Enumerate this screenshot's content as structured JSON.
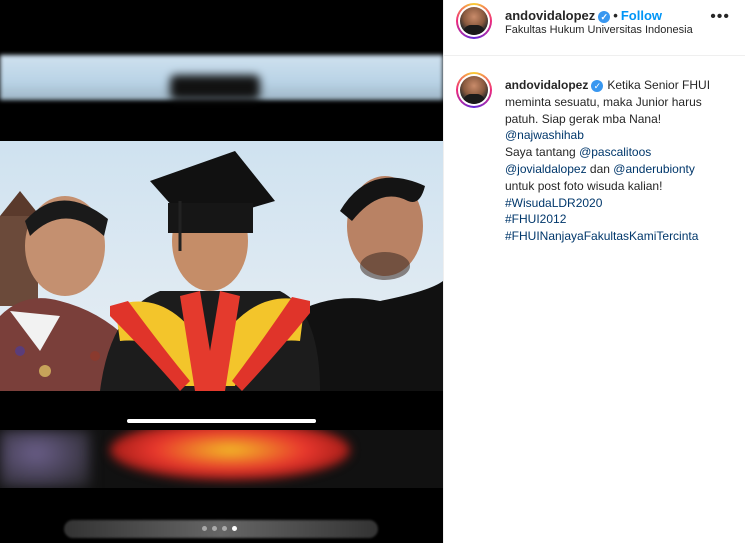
{
  "post": {
    "username": "andovidalopez",
    "verified_glyph": "✓",
    "separator": "•",
    "follow_label": "Follow",
    "location": "Fakultas Hukum Universitas Indonesia",
    "more_icon": "more-options-icon"
  },
  "caption": {
    "username": "andovidalopez",
    "lines": [
      [
        {
          "t": "text",
          "v": "Ketika Senior FHUI"
        }
      ],
      [
        {
          "t": "text",
          "v": "meminta sesuatu, maka Junior harus"
        }
      ],
      [
        {
          "t": "text",
          "v": "patuh. Siap gerak mba Nana!"
        }
      ],
      [
        {
          "t": "mention",
          "v": "@najwashihab"
        }
      ],
      [
        {
          "t": "text",
          "v": "Saya tantang "
        },
        {
          "t": "mention",
          "v": "@pascalitoos"
        }
      ],
      [
        {
          "t": "mention",
          "v": "@jovialdalopez"
        },
        {
          "t": "text",
          "v": " dan "
        },
        {
          "t": "mention",
          "v": "@anderubionty"
        }
      ],
      [
        {
          "t": "text",
          "v": "untuk post foto wisuda kalian!"
        }
      ],
      [
        {
          "t": "hashtag",
          "v": "#WisudaLDR2020"
        }
      ],
      [
        {
          "t": "hashtag",
          "v": "#FHUI2012"
        }
      ],
      [
        {
          "t": "hashtag",
          "v": "#FHUINanjayaFakultasKamiTercinta"
        }
      ]
    ]
  },
  "media": {
    "carousel_dots": 4,
    "active_dot": 3,
    "video_progress": 1.0,
    "prev_icon": "‹"
  },
  "colors": {
    "link": "#00376b",
    "follow": "#0095f6",
    "verified": "#3897f0"
  }
}
